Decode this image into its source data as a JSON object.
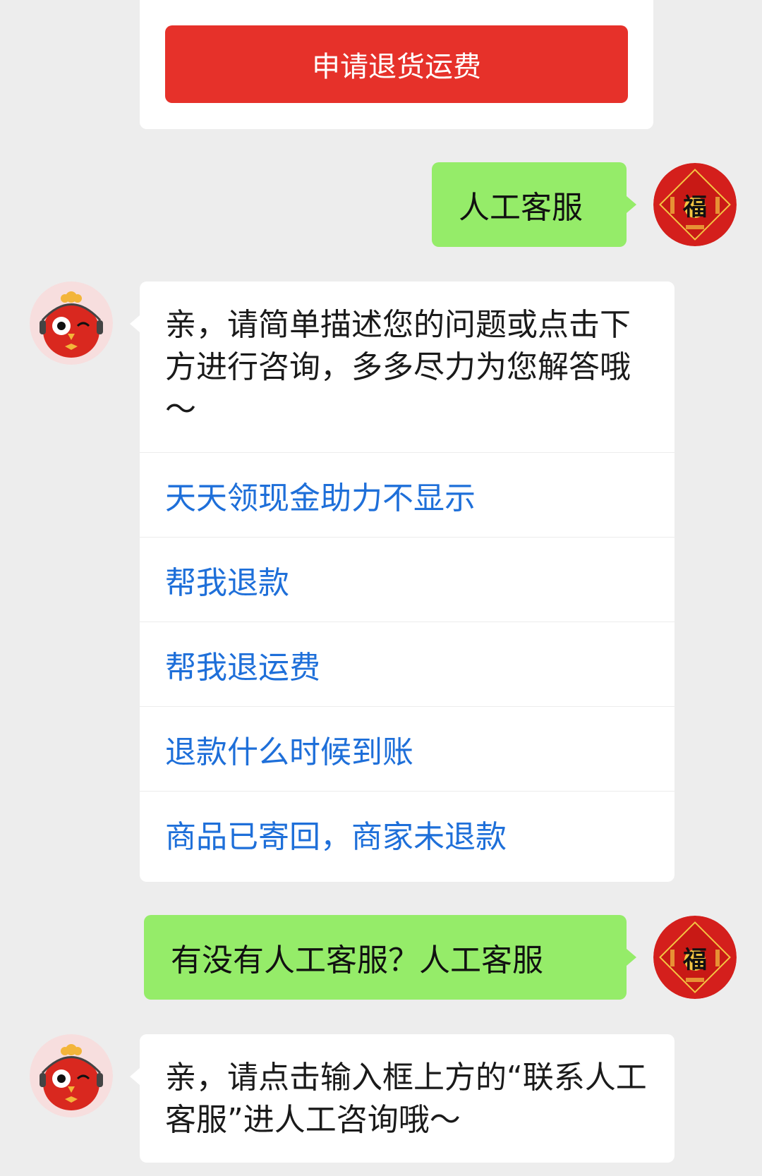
{
  "top_card": {
    "button_label": "申请退货运费",
    "button_color": "#e6312a"
  },
  "messages": [
    {
      "role": "user",
      "text": "人工客服",
      "avatar_icon": "fu-character-avatar-icon"
    },
    {
      "role": "bot",
      "text": "亲，请简单描述您的问题或点击下方进行咨询，多多尽力为您解答哦～",
      "avatar_icon": "cartoon-bird-agent-avatar-icon",
      "faq": [
        "天天领现金助力不显示",
        "帮我退款",
        "帮我退运费",
        "退款什么时候到账",
        "商品已寄回，商家未退款"
      ]
    },
    {
      "role": "user",
      "text": "有没有人工客服？人工客服",
      "avatar_icon": "fu-character-avatar-icon"
    },
    {
      "role": "bot",
      "text": "亲，请点击输入框上方的“联系人工客服”进人工咨询哦～",
      "avatar_icon": "cartoon-bird-agent-avatar-icon"
    }
  ],
  "colors": {
    "background": "#ededed",
    "user_bubble": "#95ec69",
    "bot_bubble": "#ffffff",
    "link": "#1e6fd9"
  }
}
